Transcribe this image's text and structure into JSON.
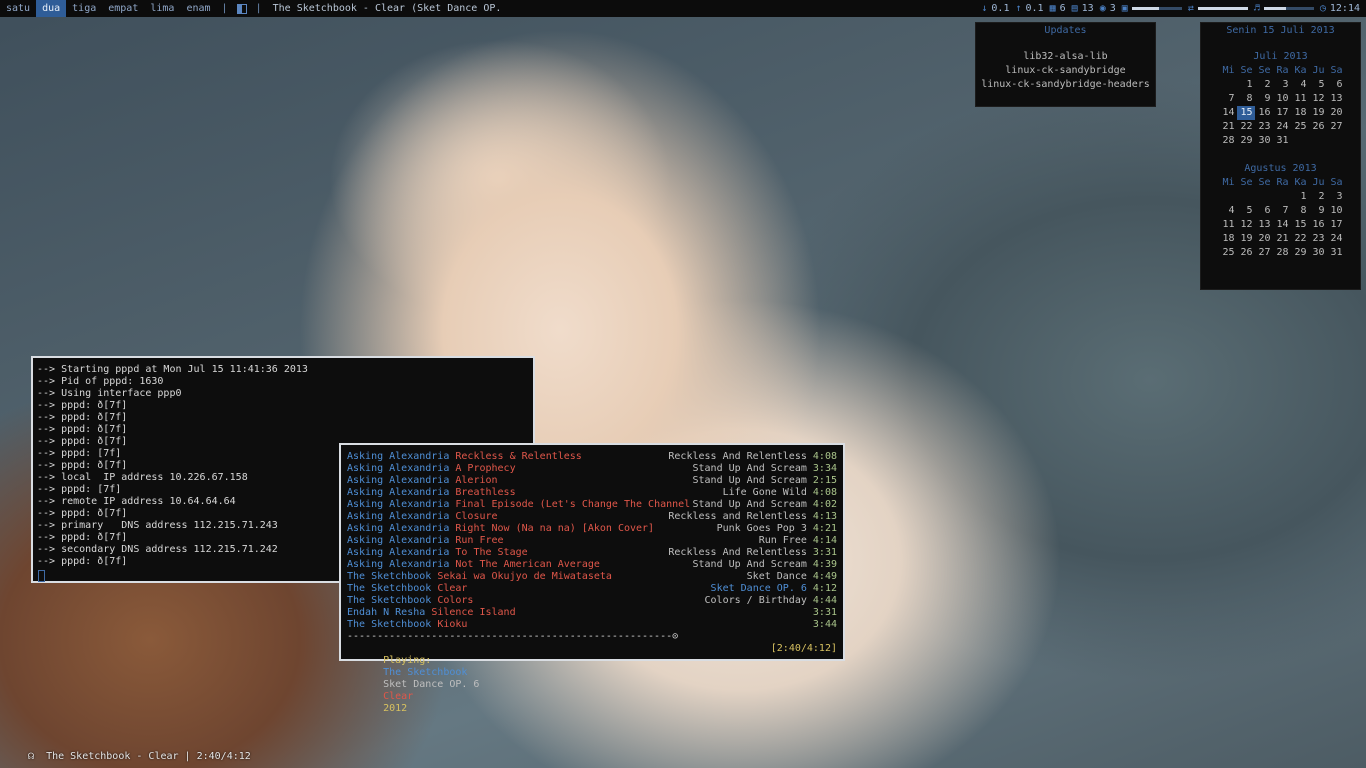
{
  "workspaces": [
    {
      "label": "satu",
      "active": false
    },
    {
      "label": "dua",
      "active": true
    },
    {
      "label": "tiga",
      "active": false
    },
    {
      "label": "empat",
      "active": false
    },
    {
      "label": "lima",
      "active": false
    },
    {
      "label": "enam",
      "active": false
    }
  ],
  "topbar": {
    "separator": "|",
    "window_title": "The Sketchbook - Clear (Sket Dance OP.",
    "net_down": "0.1",
    "net_up": "0.1",
    "cpu": "6",
    "mem": "13",
    "disk": "3",
    "brightness_level": 0.55,
    "volume_level": 0.45,
    "clock": "12:14"
  },
  "updates": {
    "title": "Updates",
    "packages": [
      "lib32-alsa-lib",
      "linux-ck-sandybridge",
      "linux-ck-sandybridge-headers"
    ]
  },
  "calendar": {
    "header": "Senin 15 Juli 2013",
    "day_names": [
      "Mi",
      "Se",
      "Se",
      "Ra",
      "Ka",
      "Ju",
      "Sa"
    ],
    "months": [
      {
        "title": "Juli 2013",
        "weeks": [
          [
            "",
            "1",
            "2",
            "3",
            "4",
            "5",
            "6"
          ],
          [
            "7",
            "8",
            "9",
            "10",
            "11",
            "12",
            "13"
          ],
          [
            "14",
            "15",
            "16",
            "17",
            "18",
            "19",
            "20"
          ],
          [
            "21",
            "22",
            "23",
            "24",
            "25",
            "26",
            "27"
          ],
          [
            "28",
            "29",
            "30",
            "31",
            "",
            "",
            ""
          ]
        ],
        "today": "15"
      },
      {
        "title": "Agustus 2013",
        "weeks": [
          [
            "",
            "",
            "",
            "",
            "1",
            "2",
            "3"
          ],
          [
            "4",
            "5",
            "6",
            "7",
            "8",
            "9",
            "10"
          ],
          [
            "11",
            "12",
            "13",
            "14",
            "15",
            "16",
            "17"
          ],
          [
            "18",
            "19",
            "20",
            "21",
            "22",
            "23",
            "24"
          ],
          [
            "25",
            "26",
            "27",
            "28",
            "29",
            "30",
            "31"
          ]
        ],
        "today": ""
      }
    ]
  },
  "terminal": {
    "lines": [
      "--> Starting pppd at Mon Jul 15 11:41:36 2013",
      "--> Pid of pppd: 1630",
      "--> Using interface ppp0",
      "--> pppd: ð[7f]",
      "--> pppd: ð[7f]",
      "--> pppd: ð[7f]",
      "--> pppd: ð[7f]",
      "--> pppd: [7f]",
      "--> pppd: ð[7f]",
      "--> local  IP address 10.226.67.158",
      "--> pppd: [7f]",
      "--> remote IP address 10.64.64.64",
      "--> pppd: ð[7f]",
      "--> primary   DNS address 112.215.71.243",
      "--> pppd: ð[7f]",
      "--> secondary DNS address 112.215.71.242",
      "--> pppd: ð[7f]"
    ]
  },
  "playlist": [
    {
      "artist": "Asking Alexandria",
      "title": "Reckless & Relentless",
      "album": "Reckless And Relentless",
      "time": "4:08"
    },
    {
      "artist": "Asking Alexandria",
      "title": "A Prophecy",
      "album": "Stand Up And Scream",
      "time": "3:34"
    },
    {
      "artist": "Asking Alexandria",
      "title": "Alerion",
      "album": "Stand Up And Scream",
      "time": "2:15"
    },
    {
      "artist": "Asking Alexandria",
      "title": "Breathless",
      "album": "Life Gone Wild",
      "time": "4:08"
    },
    {
      "artist": "Asking Alexandria",
      "title": "Final Episode (Let's Change The Channel",
      "album": "Stand Up And Scream",
      "time": "4:02"
    },
    {
      "artist": "Asking Alexandria",
      "title": "Closure",
      "album": "Reckless and Relentless",
      "time": "4:13"
    },
    {
      "artist": "Asking Alexandria",
      "title": "Right Now (Na na na) [Akon Cover]",
      "album": "Punk Goes Pop 3",
      "time": "4:21"
    },
    {
      "artist": "Asking Alexandria",
      "title": "Run Free",
      "album": "Run Free",
      "time": "4:14"
    },
    {
      "artist": "Asking Alexandria",
      "title": "To The Stage",
      "album": "Reckless And Relentless",
      "time": "3:31"
    },
    {
      "artist": "Asking Alexandria",
      "title": "Not The American Average",
      "album": "Stand Up And Scream",
      "time": "4:39"
    },
    {
      "artist": "The Sketchbook",
      "title": "Sekai wa Okujyo de Miwataseta",
      "album": "Sket Dance",
      "time": "4:49"
    },
    {
      "artist": "The Sketchbook",
      "title": "Clear",
      "album": "Sket Dance OP. 6",
      "time": "4:12",
      "current": true
    },
    {
      "artist": "The Sketchbook",
      "title": "Colors",
      "album": "Colors / Birthday",
      "time": "4:44"
    },
    {
      "artist": "Endah N Resha",
      "title": "Silence Island",
      "album": "",
      "time": "3:31"
    },
    {
      "artist": "The Sketchbook",
      "title": "Kioku",
      "album": "",
      "time": "3:44"
    }
  ],
  "progress_line": "------------------------------------------------------⊙",
  "now_playing": {
    "label": "Playing:",
    "artist": "The Sketchbook",
    "album": "Sket Dance OP. 6",
    "title": "Clear",
    "year": "2012",
    "elapsed": "[2:40/4:12]"
  },
  "bottom_status": "The Sketchbook - Clear | 2:40/4:12",
  "bottom_icon": "☊"
}
